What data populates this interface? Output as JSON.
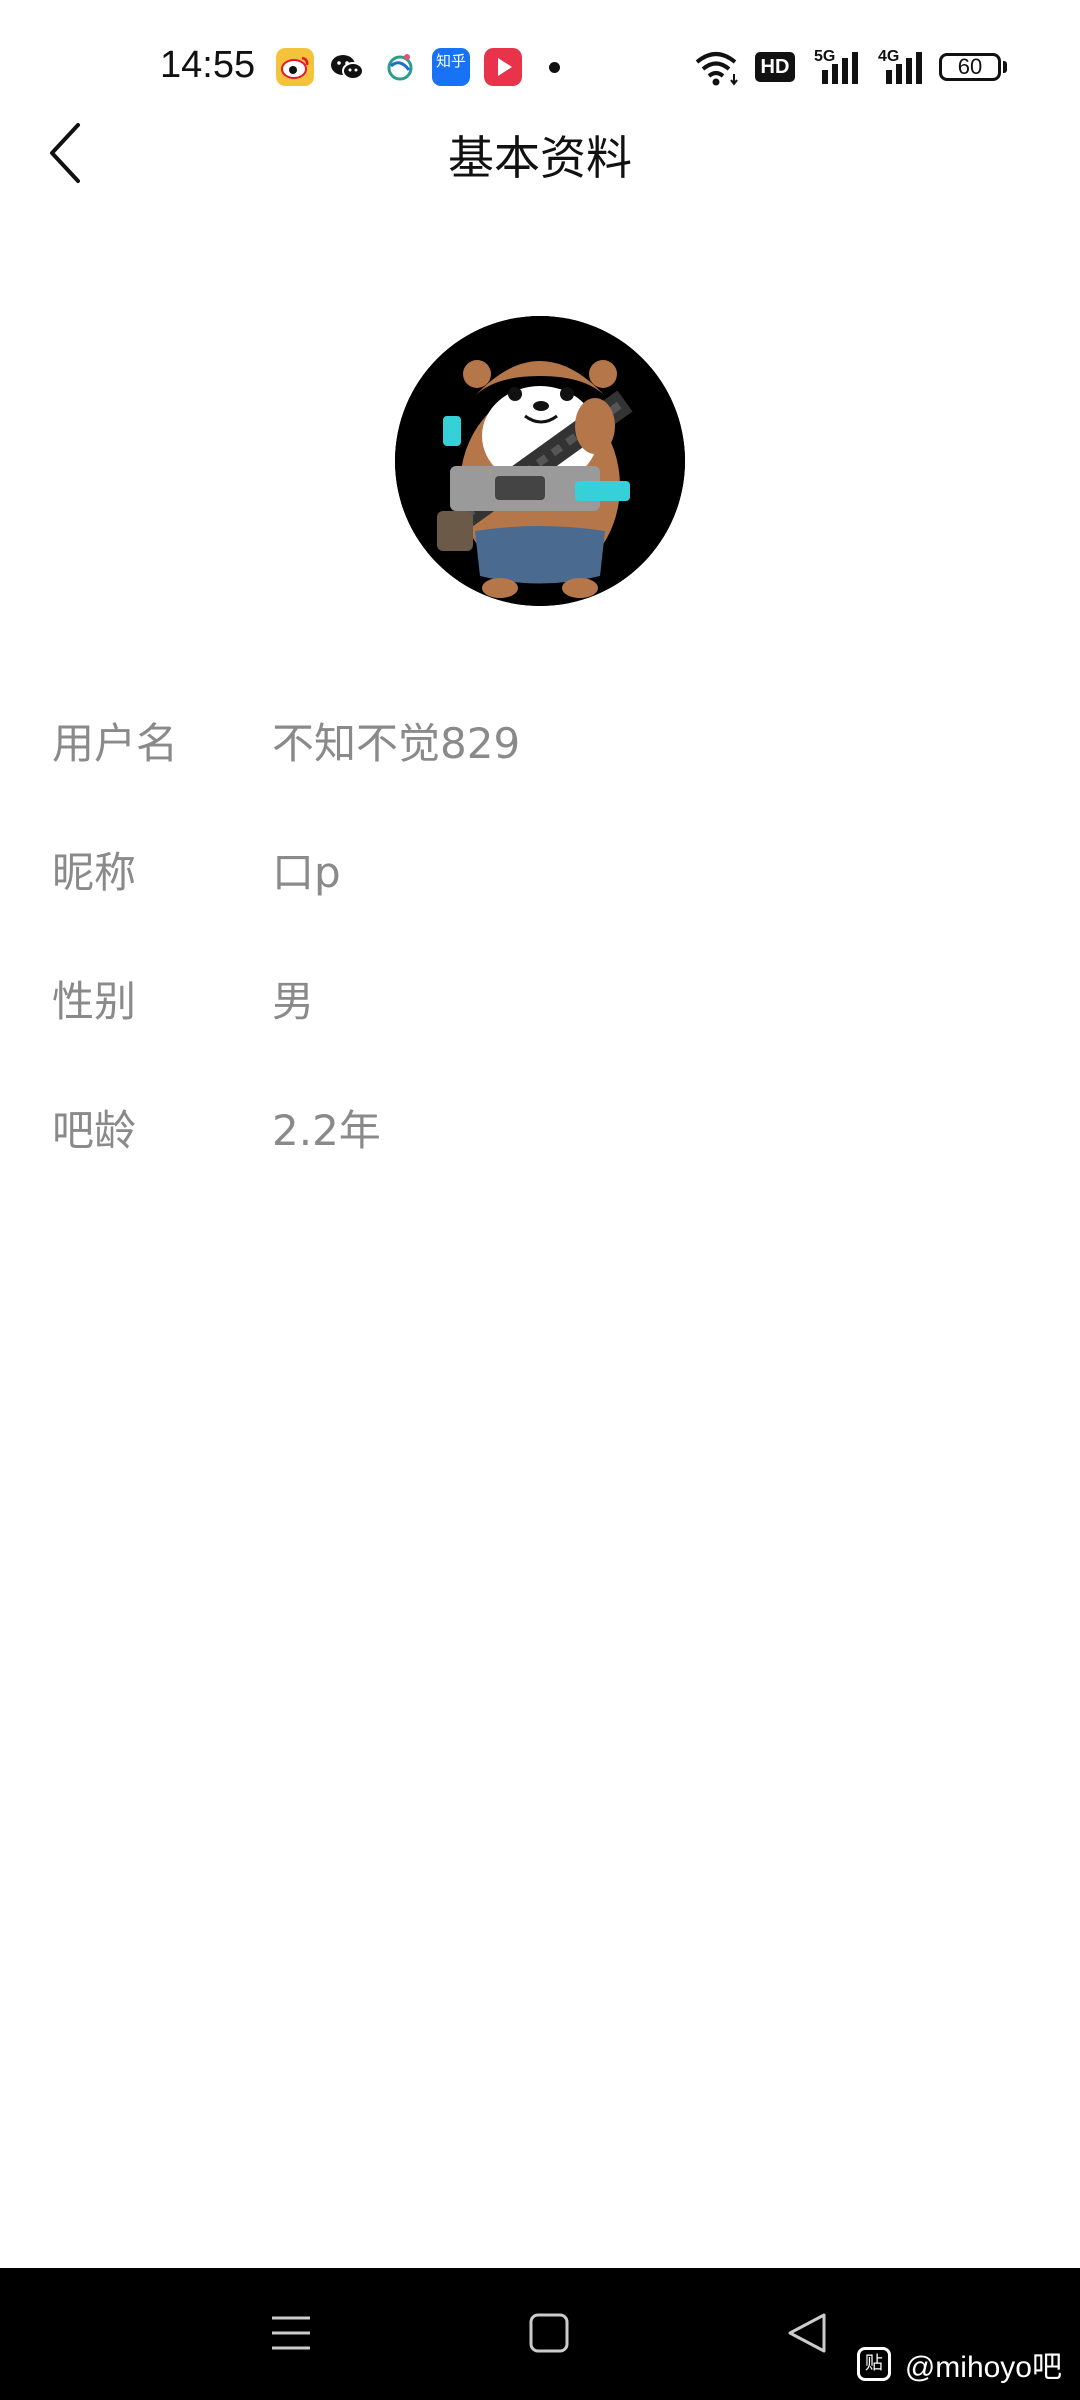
{
  "status_bar": {
    "time": "14:55",
    "app_icons": [
      "weibo-icon",
      "wechat-icon",
      "china-mobile-icon",
      "zhihu-icon",
      "video-app-icon"
    ],
    "zhihu_label": "知乎",
    "hd_label": "HD",
    "net_5g": "5G",
    "net_4g": "4G",
    "battery": "60"
  },
  "header": {
    "title": "基本资料",
    "back_icon": "chevron-left-icon"
  },
  "profile": {
    "avatar_icon": "otter-avatar",
    "fields": [
      {
        "label": "用户名",
        "value": "不知不觉829"
      },
      {
        "label": "昵称",
        "value": "口p"
      },
      {
        "label": "性别",
        "value": "男"
      },
      {
        "label": "吧龄",
        "value": "2.2年"
      }
    ]
  },
  "nav_bar": {
    "menu_icon": "menu-icon",
    "home_icon": "home-square-icon",
    "back_icon": "back-triangle-icon",
    "watermark_logo": "贴",
    "watermark_text": "@mihoyo吧"
  },
  "colors": {
    "label_gray": "#8a8a8a",
    "title_black": "#111111",
    "nav_black": "#000000"
  }
}
